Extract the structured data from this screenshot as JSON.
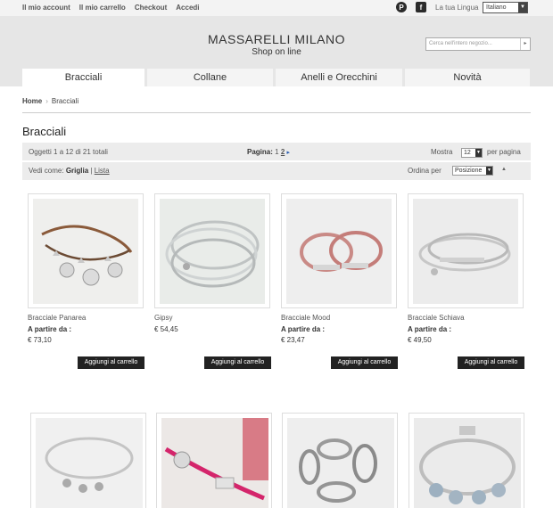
{
  "top": {
    "links": [
      "Il mio account",
      "Il mio carrello",
      "Checkout",
      "Accedi"
    ],
    "social": [
      {
        "icon": "pinterest-icon",
        "glyph": "P"
      },
      {
        "icon": "facebook-icon",
        "glyph": "f"
      }
    ],
    "lang_label": "La tua Lingua",
    "lang_value": "Italiano"
  },
  "header": {
    "brand": "MASSARELLI MILANO",
    "subtitle": "Shop on line",
    "search_placeholder": "Cerca nell'intero negozio...",
    "search_go": "▸"
  },
  "nav": {
    "tabs": [
      {
        "label": "Bracciali",
        "active": true
      },
      {
        "label": "Collane",
        "active": false
      },
      {
        "label": "Anelli e Orecchini",
        "active": false
      },
      {
        "label": "Novità",
        "active": false
      }
    ]
  },
  "breadcrumb": {
    "home": "Home",
    "sep": "›",
    "current": "Bracciali"
  },
  "page_title": "Bracciali",
  "toolbar": {
    "count_text": "Oggetti 1 a 12 di 21 totali",
    "page_label": "Pagina:",
    "page_1": "1",
    "page_2": "2",
    "next": "▸",
    "show_label": "Mostra",
    "show_value": "12",
    "per_page": "per pagina",
    "view_label": "Vedi come:",
    "view_grid": "Griglia",
    "view_sep": "|",
    "view_list": "Lista",
    "sort_label": "Ordina per",
    "sort_value": "Posizione",
    "sort_dir": "▲"
  },
  "products": [
    {
      "name": "Bracciale Panarea",
      "from": "A partire da :",
      "price": "€ 73,10",
      "button": "Aggiungi al carrello"
    },
    {
      "name": "Gipsy",
      "from": "",
      "price": "€ 54,45",
      "button": "Aggiungi al carrello"
    },
    {
      "name": "Bracciale Mood",
      "from": "A partire da :",
      "price": "€ 23,47",
      "button": "Aggiungi al carrello"
    },
    {
      "name": "Bracciale Schiava",
      "from": "A partire da :",
      "price": "€ 49,50",
      "button": "Aggiungi al carrello"
    }
  ]
}
